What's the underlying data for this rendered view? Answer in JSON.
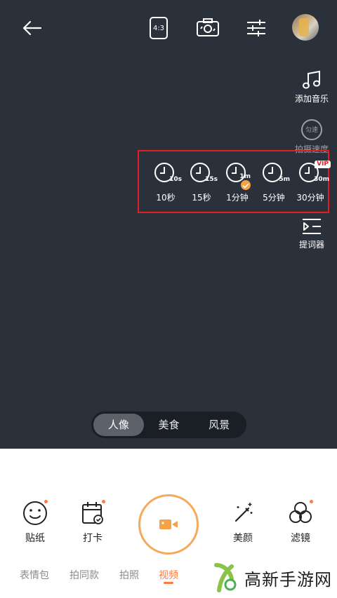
{
  "right_tools": {
    "music_label": "添加音乐",
    "speed_badge": "匀速",
    "speed_label": "拍摄速度",
    "teleprompter_label": "提词器"
  },
  "timer": {
    "options": [
      {
        "cap": "10s",
        "label": "10秒"
      },
      {
        "cap": "15s",
        "label": "15秒"
      },
      {
        "cap": "1m",
        "label": "1分钟",
        "selected": true
      },
      {
        "cap": "5m",
        "label": "5分钟"
      },
      {
        "cap": "30m",
        "label": "30分钟",
        "vip": "VIP"
      }
    ]
  },
  "top_bar": {
    "ratio_label": "4:3"
  },
  "modes": {
    "items": [
      "人像",
      "美食",
      "风景"
    ],
    "active": "人像"
  },
  "panel": {
    "sticker_label": "贴纸",
    "checkin_label": "打卡",
    "beauty_label": "美颜",
    "filter_label": "滤镜"
  },
  "tabs": {
    "items": [
      "表情包",
      "拍同款",
      "拍照",
      "视频"
    ],
    "active": "视频"
  },
  "watermark": {
    "text": "高新手游网"
  },
  "colors": {
    "accent": "#ff7a3c",
    "shutter_ring": "#f6a95c",
    "highlight_box": "#e02020",
    "background": "#2b313b"
  }
}
